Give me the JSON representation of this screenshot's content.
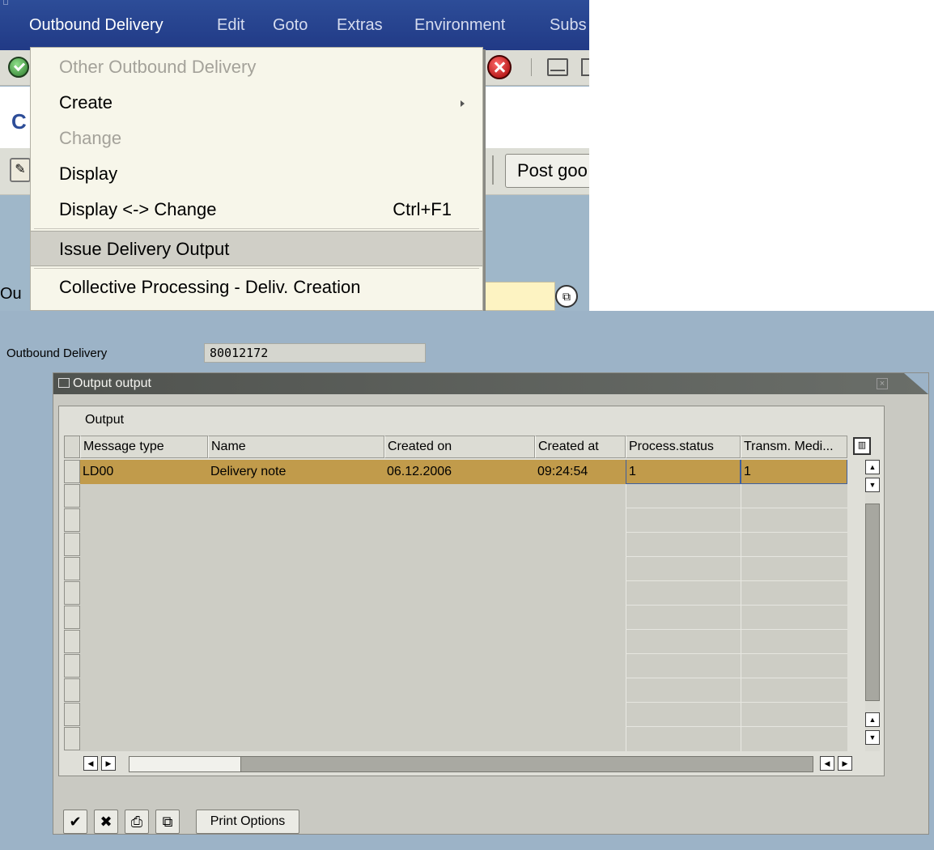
{
  "menubar": {
    "items": [
      "Outbound Delivery",
      "Edit",
      "Goto",
      "Extras",
      "Environment",
      "Subs"
    ]
  },
  "title_fragment": "C",
  "post_goods_button": "Post goo",
  "field_fragment": "Ou",
  "dropdown": {
    "items": [
      {
        "label": "Other Outbound Delivery",
        "disabled": true
      },
      {
        "label": "Create",
        "submenu": true
      },
      {
        "label": "Change",
        "disabled": true
      },
      {
        "label": "Display"
      },
      {
        "label": "Display <-> Change",
        "shortcut": "Ctrl+F1"
      },
      {
        "label": "Issue Delivery Output",
        "selected": true
      },
      {
        "label": "Collective Processing - Deliv. Creation"
      }
    ]
  },
  "outbound_delivery": {
    "label": "Outbound Delivery",
    "value": "80012172"
  },
  "dialog": {
    "title": "Output output",
    "close_label": "×",
    "table_title": "Output",
    "columns": [
      "Message type",
      "Name",
      "Created on",
      "Created at",
      "Process.status",
      "Transm. Medi..."
    ],
    "row": [
      "LD00",
      "Delivery note",
      "06.12.2006",
      "09:24:54",
      "1",
      "1"
    ],
    "print_options_label": "Print Options"
  },
  "icons": {
    "col_config": "grid-config-icon",
    "confirm": "checkmark-icon",
    "cancel": "cancel-icon",
    "print": "print-icon",
    "print_preview": "print-preview-icon"
  },
  "colors": {
    "menubar": "#2d4d98",
    "background": "#9cb3c7",
    "selected_row": "#c19b4b",
    "highlight_input": "#fdf3c2"
  }
}
